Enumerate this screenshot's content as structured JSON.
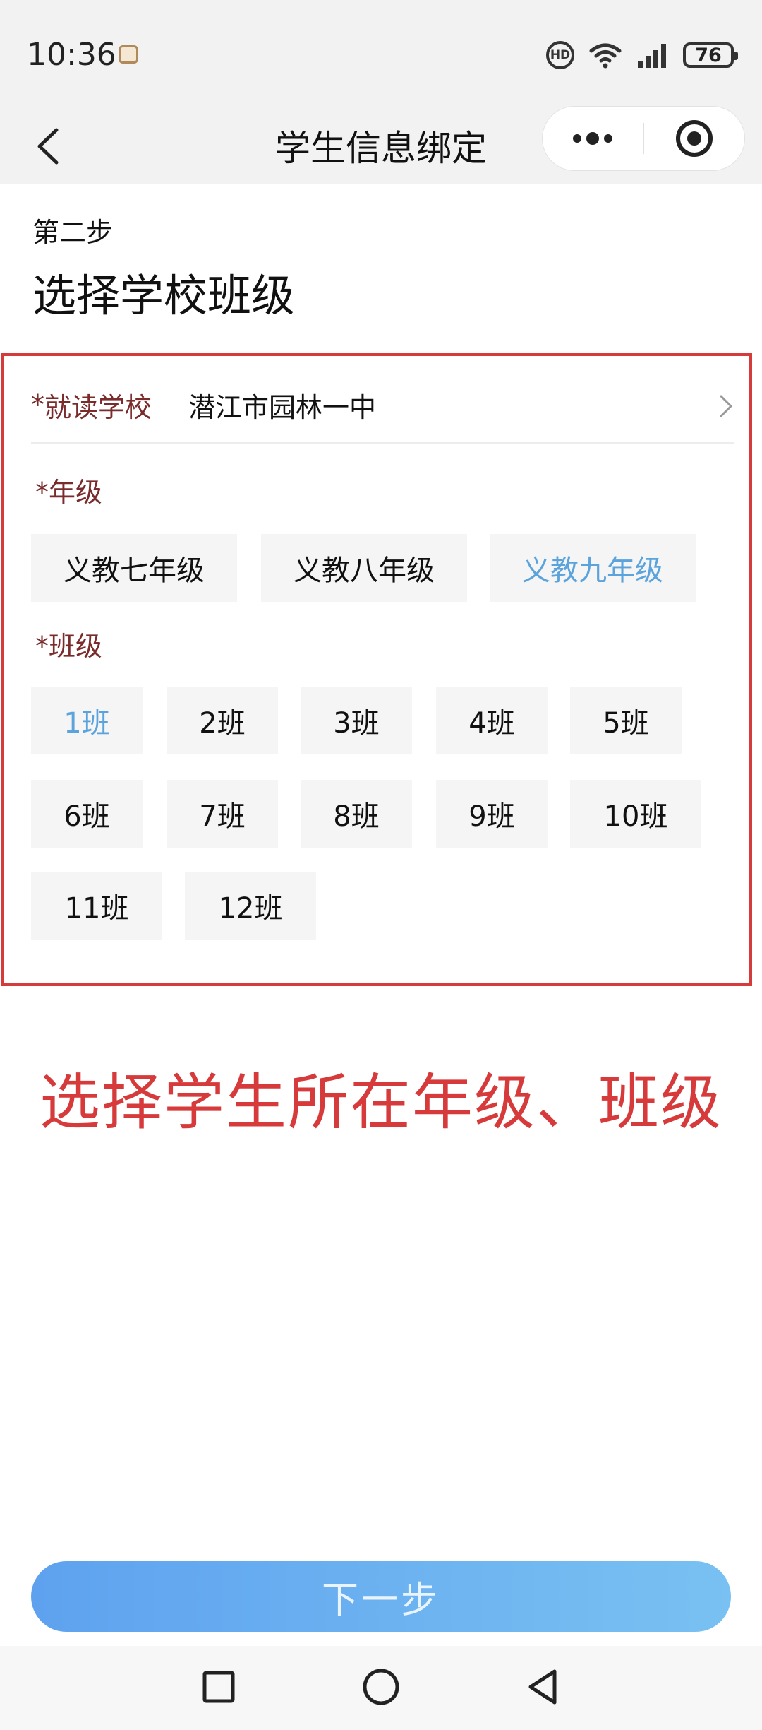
{
  "status_bar": {
    "time": "10:36",
    "hd_label": "HD",
    "battery": "76"
  },
  "nav": {
    "title": "学生信息绑定",
    "more_icon": "ellipsis-icon",
    "close_icon": "target-close-icon"
  },
  "step": {
    "label": "第二步",
    "title": "选择学校班级"
  },
  "school": {
    "required_mark": "*",
    "label": "就读学校",
    "value": "潜江市园林一中"
  },
  "grade": {
    "required_mark": "*",
    "label": "年级",
    "options": [
      "义教七年级",
      "义教八年级",
      "义教九年级"
    ],
    "selected": "义教九年级"
  },
  "class": {
    "required_mark": "*",
    "label": "班级",
    "options": [
      "1班",
      "2班",
      "3班",
      "4班",
      "5班",
      "6班",
      "7班",
      "8班",
      "9班",
      "10班",
      "11班",
      "12班"
    ],
    "selected": "1班"
  },
  "caption": "选择学生所在年级、班级",
  "next_button": "下一步",
  "colors": {
    "highlight_border": "#d63a3a",
    "selected_chip_text": "#5ba3dc",
    "label_text": "#7a2b2b",
    "button_gradient_start": "#5ea2ef",
    "button_gradient_end": "#79c1f2"
  }
}
